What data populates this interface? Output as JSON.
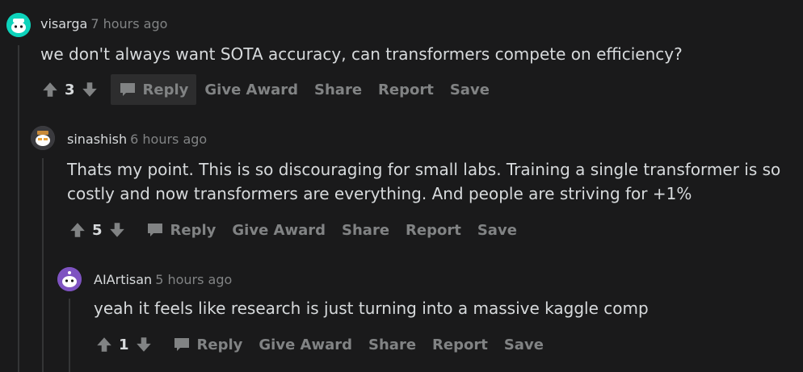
{
  "comments": [
    {
      "author": "visarga",
      "time": "7 hours ago",
      "body": "we don't always want SOTA accuracy, can transformers compete on efficiency?",
      "score": "3",
      "actions": {
        "reply": "Reply",
        "award": "Give Award",
        "share": "Share",
        "report": "Report",
        "save": "Save"
      }
    },
    {
      "author": "sinashish",
      "time": "6 hours ago",
      "body": "Thats my point. This is so discouraging for small labs. Training a single transformer is so costly and now transformers are everything. And people are striving for +1%",
      "score": "5",
      "actions": {
        "reply": "Reply",
        "award": "Give Award",
        "share": "Share",
        "report": "Report",
        "save": "Save"
      }
    },
    {
      "author": "AIArtisan",
      "time": "5 hours ago",
      "body": "yeah it feels like research is just turning into a massive kaggle comp",
      "score": "1",
      "actions": {
        "reply": "Reply",
        "award": "Give Award",
        "share": "Share",
        "report": "Report",
        "save": "Save"
      }
    }
  ],
  "icons": {
    "upvote": "upvote-arrow-icon",
    "downvote": "downvote-arrow-icon",
    "reply": "speech-bubble-icon",
    "avatar": "snoo-avatar-icon"
  },
  "colors": {
    "background": "#1a1a1b",
    "text": "#d7dadc",
    "muted": "#818384",
    "thread_line": "#343536"
  }
}
